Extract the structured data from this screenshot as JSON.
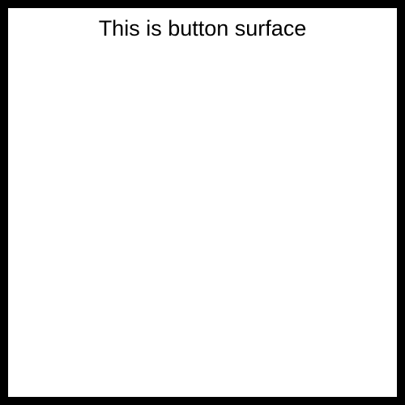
{
  "button_surface": {
    "label": "This is button surface",
    "border_color": "#000000",
    "background_color": "#ffffff",
    "text_color": "#000000"
  }
}
